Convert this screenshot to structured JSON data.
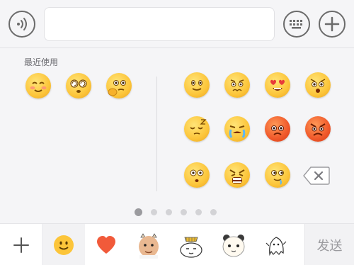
{
  "input": {
    "value": "",
    "placeholder": ""
  },
  "icons": {
    "voice": "voice-wave-icon",
    "keyboard": "keyboard-icon",
    "more": "plus-icon",
    "delete": "backspace-icon",
    "add_pack": "plus-icon"
  },
  "recent": {
    "label": "最近使用"
  },
  "recent_emojis": [
    "smile-blush",
    "dizzy-eyes",
    "thinking-hand"
  ],
  "grid_emojis": [
    "smile",
    "worried",
    "heart-eyes",
    "shocked",
    "sleepy",
    "crying",
    "angry-red",
    "furious-red",
    "scared",
    "screaming",
    "drooling",
    "delete"
  ],
  "pager": {
    "total": 6,
    "current": 0
  },
  "tabs": [
    "add",
    "emoji",
    "heart",
    "baby-sticker",
    "bun-sticker",
    "panda-sticker",
    "ghost-sticker"
  ],
  "send": {
    "label": "发送"
  },
  "colors": {
    "accent": "#fcc53a",
    "heart": "#f15a3a",
    "text_muted": "#9a9a9e"
  }
}
